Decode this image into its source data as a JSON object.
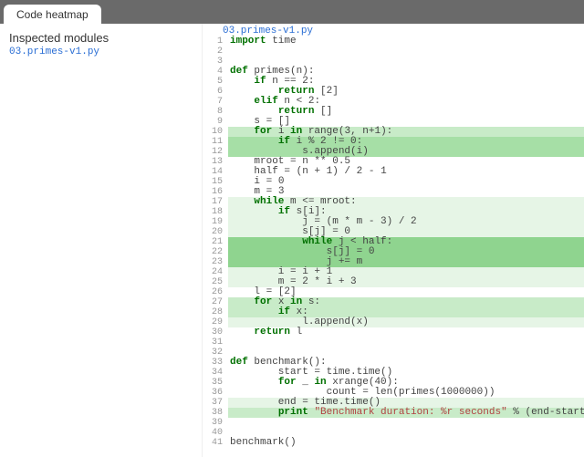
{
  "topbar": {
    "tab_label": "Code heatmap"
  },
  "sidebar": {
    "title": "Inspected modules",
    "module_link": "03.primes-v1.py"
  },
  "main": {
    "filename": "03.primes-v1.py",
    "lines": [
      {
        "n": 1,
        "heat": 0,
        "tok": [
          [
            "kw",
            "import"
          ],
          [
            "",
            " time"
          ]
        ]
      },
      {
        "n": 2,
        "heat": 0,
        "tok": [
          [
            "",
            ""
          ]
        ]
      },
      {
        "n": 3,
        "heat": 0,
        "tok": [
          [
            "",
            ""
          ]
        ]
      },
      {
        "n": 4,
        "heat": 0,
        "tok": [
          [
            "kw",
            "def"
          ],
          [
            "",
            " primes(n):"
          ]
        ]
      },
      {
        "n": 5,
        "heat": 0,
        "tok": [
          [
            "",
            "    "
          ],
          [
            "kw",
            "if"
          ],
          [
            "",
            " n == "
          ],
          [
            "num",
            "2"
          ],
          [
            "",
            ":"
          ]
        ]
      },
      {
        "n": 6,
        "heat": 0,
        "tok": [
          [
            "",
            "        "
          ],
          [
            "kw",
            "return"
          ],
          [
            "",
            " ["
          ],
          [
            "num",
            "2"
          ],
          [
            "",
            "]"
          ]
        ]
      },
      {
        "n": 7,
        "heat": 0,
        "tok": [
          [
            "",
            "    "
          ],
          [
            "kw",
            "elif"
          ],
          [
            "",
            " n < "
          ],
          [
            "num",
            "2"
          ],
          [
            "",
            ":"
          ]
        ]
      },
      {
        "n": 8,
        "heat": 0,
        "tok": [
          [
            "",
            "        "
          ],
          [
            "kw",
            "return"
          ],
          [
            "",
            " []"
          ]
        ]
      },
      {
        "n": 9,
        "heat": 0,
        "tok": [
          [
            "",
            "    s = []"
          ]
        ]
      },
      {
        "n": 10,
        "heat": 2,
        "tok": [
          [
            "",
            "    "
          ],
          [
            "kw",
            "for"
          ],
          [
            "",
            " i "
          ],
          [
            "kw",
            "in"
          ],
          [
            "",
            " range("
          ],
          [
            "num",
            "3"
          ],
          [
            "",
            ", n+"
          ],
          [
            "num",
            "1"
          ],
          [
            "",
            "):"
          ]
        ]
      },
      {
        "n": 11,
        "heat": 3,
        "tok": [
          [
            "",
            "        "
          ],
          [
            "kw",
            "if"
          ],
          [
            "",
            " i % "
          ],
          [
            "num",
            "2"
          ],
          [
            "",
            " != "
          ],
          [
            "num",
            "0"
          ],
          [
            "",
            ":"
          ]
        ]
      },
      {
        "n": 12,
        "heat": 3,
        "tok": [
          [
            "",
            "            s.append(i)"
          ]
        ]
      },
      {
        "n": 13,
        "heat": 0,
        "tok": [
          [
            "",
            "    mroot = n ** "
          ],
          [
            "num",
            "0.5"
          ]
        ]
      },
      {
        "n": 14,
        "heat": 0,
        "tok": [
          [
            "",
            "    half = (n + "
          ],
          [
            "num",
            "1"
          ],
          [
            "",
            ") / "
          ],
          [
            "num",
            "2"
          ],
          [
            "",
            " - "
          ],
          [
            "num",
            "1"
          ]
        ]
      },
      {
        "n": 15,
        "heat": 0,
        "tok": [
          [
            "",
            "    i = "
          ],
          [
            "num",
            "0"
          ]
        ]
      },
      {
        "n": 16,
        "heat": 0,
        "tok": [
          [
            "",
            "    m = "
          ],
          [
            "num",
            "3"
          ]
        ]
      },
      {
        "n": 17,
        "heat": 1,
        "tok": [
          [
            "",
            "    "
          ],
          [
            "kw",
            "while"
          ],
          [
            "",
            " m <= mroot:"
          ]
        ]
      },
      {
        "n": 18,
        "heat": 1,
        "tok": [
          [
            "",
            "        "
          ],
          [
            "kw",
            "if"
          ],
          [
            "",
            " s[i]:"
          ]
        ]
      },
      {
        "n": 19,
        "heat": 1,
        "tok": [
          [
            "",
            "            j = (m * m - "
          ],
          [
            "num",
            "3"
          ],
          [
            "",
            ") / "
          ],
          [
            "num",
            "2"
          ]
        ]
      },
      {
        "n": 20,
        "heat": 1,
        "tok": [
          [
            "",
            "            s[j] = "
          ],
          [
            "num",
            "0"
          ]
        ]
      },
      {
        "n": 21,
        "heat": 4,
        "tok": [
          [
            "",
            "            "
          ],
          [
            "kw",
            "while"
          ],
          [
            "",
            " j < half:"
          ]
        ]
      },
      {
        "n": 22,
        "heat": 4,
        "tok": [
          [
            "",
            "                s[j] = "
          ],
          [
            "num",
            "0"
          ]
        ]
      },
      {
        "n": 23,
        "heat": 4,
        "tok": [
          [
            "",
            "                j += m"
          ]
        ]
      },
      {
        "n": 24,
        "heat": 1,
        "tok": [
          [
            "",
            "        i = i + "
          ],
          [
            "num",
            "1"
          ]
        ]
      },
      {
        "n": 25,
        "heat": 1,
        "tok": [
          [
            "",
            "        m = "
          ],
          [
            "num",
            "2"
          ],
          [
            "",
            " * i + "
          ],
          [
            "num",
            "3"
          ]
        ]
      },
      {
        "n": 26,
        "heat": 0,
        "tok": [
          [
            "",
            "    l = ["
          ],
          [
            "num",
            "2"
          ],
          [
            "",
            "]"
          ]
        ]
      },
      {
        "n": 27,
        "heat": 2,
        "tok": [
          [
            "",
            "    "
          ],
          [
            "kw",
            "for"
          ],
          [
            "",
            " x "
          ],
          [
            "kw",
            "in"
          ],
          [
            "",
            " s:"
          ]
        ]
      },
      {
        "n": 28,
        "heat": 2,
        "tok": [
          [
            "",
            "        "
          ],
          [
            "kw",
            "if"
          ],
          [
            "",
            " x:"
          ]
        ]
      },
      {
        "n": 29,
        "heat": 1,
        "tok": [
          [
            "",
            "            l.append(x)"
          ]
        ]
      },
      {
        "n": 30,
        "heat": 0,
        "tok": [
          [
            "",
            "    "
          ],
          [
            "kw",
            "return"
          ],
          [
            "",
            " l"
          ]
        ]
      },
      {
        "n": 31,
        "heat": 0,
        "tok": [
          [
            "",
            ""
          ]
        ]
      },
      {
        "n": 32,
        "heat": 0,
        "tok": [
          [
            "",
            ""
          ]
        ]
      },
      {
        "n": 33,
        "heat": 0,
        "tok": [
          [
            "kw",
            "def"
          ],
          [
            "",
            " benchmark():"
          ]
        ]
      },
      {
        "n": 34,
        "heat": 0,
        "tok": [
          [
            "",
            "        start = time.time()"
          ]
        ]
      },
      {
        "n": 35,
        "heat": 0,
        "tok": [
          [
            "",
            "        "
          ],
          [
            "kw",
            "for"
          ],
          [
            "",
            " _ "
          ],
          [
            "kw",
            "in"
          ],
          [
            "",
            " xrange("
          ],
          [
            "num",
            "40"
          ],
          [
            "",
            "):"
          ]
        ]
      },
      {
        "n": 36,
        "heat": 0,
        "tok": [
          [
            "",
            "                count = len(primes("
          ],
          [
            "num",
            "1000000"
          ],
          [
            "",
            "))"
          ]
        ]
      },
      {
        "n": 37,
        "heat": 1,
        "tok": [
          [
            "",
            "        end = time.time()"
          ]
        ]
      },
      {
        "n": 38,
        "heat": 2,
        "tok": [
          [
            "",
            "        "
          ],
          [
            "kw",
            "print"
          ],
          [
            "",
            " "
          ],
          [
            "str",
            "\"Benchmark duration: %r seconds\""
          ],
          [
            "",
            " % (end-start)"
          ]
        ]
      },
      {
        "n": 39,
        "heat": 0,
        "tok": [
          [
            "",
            ""
          ]
        ]
      },
      {
        "n": 40,
        "heat": 0,
        "tok": [
          [
            "",
            ""
          ]
        ]
      },
      {
        "n": 41,
        "heat": 0,
        "tok": [
          [
            "",
            "benchmark()"
          ]
        ]
      }
    ]
  }
}
